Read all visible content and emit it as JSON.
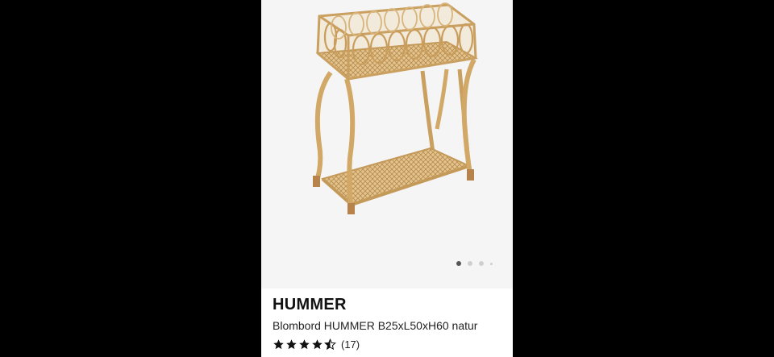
{
  "product": {
    "brand": "HUMMER",
    "description": "Blombord HUMMER B25xL50xH60 natur",
    "rating_value": 4.5,
    "rating_max": 5,
    "rating_count": "(17)",
    "image_icon": "rattan-plant-stand-image"
  },
  "carousel": {
    "total_dots": 4,
    "active_index": 0
  },
  "colors": {
    "background": "#000000",
    "card": "#ffffff",
    "image_bg": "#f5f5f5",
    "rattan": "#d4ab6a",
    "star": "#111111"
  }
}
